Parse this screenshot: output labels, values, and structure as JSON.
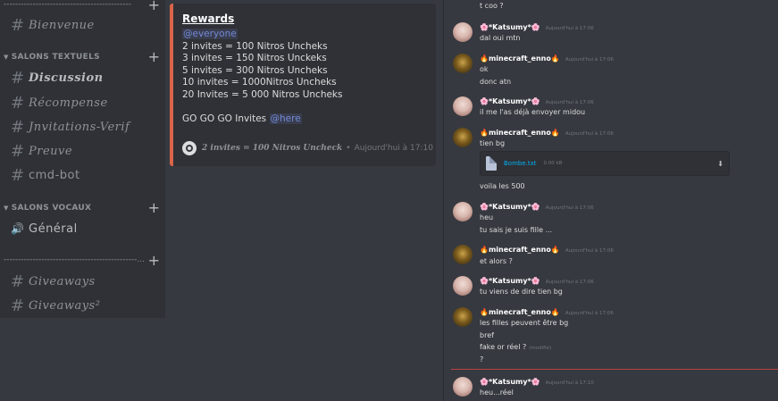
{
  "sidebar": {
    "divider_top": "--------------------------------------------",
    "channels_top": [
      {
        "name": "Bienvenue"
      }
    ],
    "category_text": "SALONS TEXTUELS",
    "channels_text": [
      {
        "name": "Discussion"
      },
      {
        "name": "Récompense"
      },
      {
        "name": "Jnvitations-Verif"
      },
      {
        "name": "Preuve"
      },
      {
        "name": "cmd-bot"
      }
    ],
    "category_voice": "SALONS VOCAUX",
    "voice_channel": "Général",
    "divider_bottom": "----------------------------------------------...",
    "channels_bottom": [
      {
        "name": "Giveaways"
      },
      {
        "name": "Giveaways²"
      }
    ],
    "plus": "+",
    "hash": "#"
  },
  "embed": {
    "title": "Rewards",
    "mention_everyone": "@everyone",
    "lines": [
      "2 invites = 100 Nitros Uncheks",
      "3 invites = 150 Nitros Unckeks",
      "5 invites = 300 Nitros Uncheks",
      "10 invites = 1000Nitros Uncheks",
      "20 Invites = 5 000 Nitros Uncheks"
    ],
    "closing_text": "GO GO GO Invites",
    "mention_here": "@here",
    "footer_text": "2 invites = 100 Nitros Uncheck",
    "footer_sep": "•",
    "footer_time": "Aujourd'hui à 17:10",
    "accent_color": "#d9644a"
  },
  "chat": {
    "top_cut_text": "t coo ?",
    "messages": [
      {
        "author": "🌸*Katsumy*🌸",
        "time": "Aujourd'hui à 17:06",
        "lines": [
          "dal oui mtn"
        ],
        "avatar": "katsumy"
      },
      {
        "author": "🔥minecraft_enno🔥",
        "time": "Aujourd'hui à 17:06",
        "lines": [
          "ok",
          "donc atn"
        ],
        "avatar": "enno"
      },
      {
        "author": "🌸*Katsumy*🌸",
        "time": "Aujourd'hui à 17:06",
        "lines": [
          "il me l'as déjà envoyer midou"
        ],
        "avatar": "katsumy"
      },
      {
        "author": "🔥minecraft_enno🔥",
        "time": "Aujourd'hui à 17:06",
        "lines": [
          "tien bg"
        ],
        "avatar": "enno"
      },
      {
        "author": "🌸*Katsumy*🌸",
        "time": "Aujourd'hui à 17:06",
        "lines": [
          "heu",
          "tu sais je suis fille ..."
        ],
        "avatar": "katsumy"
      },
      {
        "author": "🔥minecraft_enno🔥",
        "time": "Aujourd'hui à 17:06",
        "lines": [
          "et alors ?"
        ],
        "avatar": "enno"
      },
      {
        "author": "🌸*Katsumy*🌸",
        "time": "Aujourd'hui à 17:06",
        "lines": [
          "tu viens de dire tien bg"
        ],
        "avatar": "katsumy"
      },
      {
        "author": "🔥minecraft_enno🔥",
        "time": "Aujourd'hui à 17:06",
        "lines": [
          "les filles peuvent être bg",
          "bref",
          "fake or réel ?",
          "?"
        ],
        "avatar": "enno"
      },
      {
        "author": "🌸*Katsumy*🌸",
        "time": "Aujourd'hui à 17:10",
        "lines": [
          "heu...réel"
        ],
        "avatar": "katsumy"
      }
    ],
    "attachment": {
      "filename": "Bombe.txt",
      "size": "0.00 kB",
      "after_text": "voila les 500"
    },
    "edited_label": "(modifié)"
  }
}
